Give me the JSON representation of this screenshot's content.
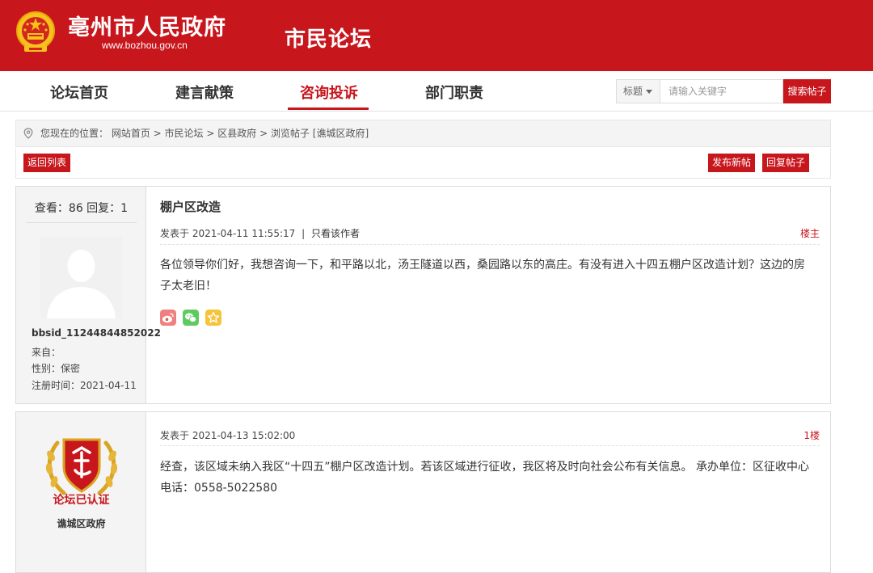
{
  "header": {
    "site_title": "亳州市人民政府",
    "site_url": "www.bozhou.gov.cn",
    "forum_title": "市民论坛"
  },
  "nav": {
    "items": [
      {
        "label": "论坛首页"
      },
      {
        "label": "建言献策"
      },
      {
        "label": "咨询投诉"
      },
      {
        "label": "部门职责"
      }
    ],
    "active": "咨询投诉"
  },
  "search": {
    "type_label": "标题",
    "placeholder": "请输入关键字",
    "button_label": "搜索帖子"
  },
  "breadcrumb": {
    "prefix": "您现在的位置：",
    "items": [
      "网站首页",
      "市民论坛",
      "区县政府",
      "浏览帖子 [谯城区政府]"
    ],
    "separator": " > "
  },
  "actions": {
    "back_label": "返回列表",
    "new_post_label": "发布新帖",
    "reply_label": "回复帖子"
  },
  "post": {
    "stats": "查看：86 回复：1",
    "username": "bbsid_11244844852022",
    "from": "来自：",
    "gender": "性别：保密",
    "register": "注册时间：2021-04-11",
    "title": "棚户区改造",
    "meta_time": "发表于 2021-04-11 11:55:17",
    "meta_sep": "|",
    "meta_author_only": "只看该作者",
    "floor": "楼主",
    "content": "各位领导你们好，我想咨询一下，和平路以北，汤王隧道以西，桑园路以东的高庄。有没有进入十四五棚户区改造计划？这边的房子太老旧！",
    "share_icons": [
      "weibo-icon",
      "wechat-icon",
      "favorite-icon"
    ]
  },
  "reply": {
    "badge_text": "论坛已认证",
    "username": "谯城区政府",
    "meta_time": "发表于 2021-04-13 15:02:00",
    "floor": "1楼",
    "content": "经查，该区域未纳入我区“十四五”棚户区改造计划。若该区域进行征收，我区将及时向社会公布有关信息。 承办单位：区征收中心 电话：0558-5022580"
  },
  "colors": {
    "brand_red": "#c8161d",
    "gold": "#d9a521"
  }
}
